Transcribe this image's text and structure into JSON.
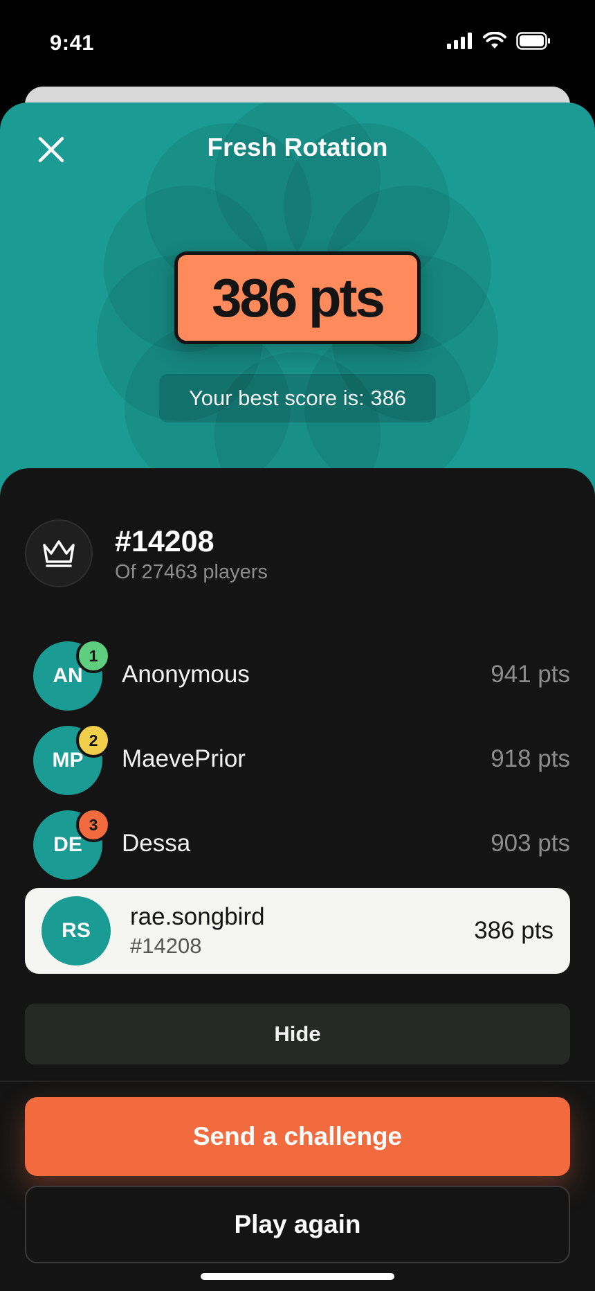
{
  "status_bar": {
    "time": "9:41"
  },
  "header": {
    "title": "Fresh Rotation",
    "score": "386 pts",
    "best_score": "Your best score is: 386",
    "bg_color": "#1a9b93",
    "score_badge_color": "#ff8a5c"
  },
  "rank": {
    "number": "#14208",
    "subtitle": "Of 27463 players"
  },
  "leaderboard": [
    {
      "initials": "AN",
      "position": "1",
      "name": "Anonymous",
      "points": "941 pts",
      "medal_color": "#5fcf7f"
    },
    {
      "initials": "MP",
      "position": "2",
      "name": "MaevePrior",
      "points": "918 pts",
      "medal_color": "#f2cf4a"
    },
    {
      "initials": "DE",
      "position": "3",
      "name": "Dessa",
      "points": "903 pts",
      "medal_color": "#f26b3f"
    }
  ],
  "me": {
    "initials": "RS",
    "name": "rae.songbird",
    "rank": "#14208",
    "points": "386 pts"
  },
  "buttons": {
    "hide": "Hide",
    "challenge": "Send a challenge",
    "play_again": "Play again"
  },
  "icons": {
    "close": "close-icon",
    "crown": "crown-icon",
    "signal": "signal-icon",
    "wifi": "wifi-icon",
    "battery": "battery-icon"
  }
}
